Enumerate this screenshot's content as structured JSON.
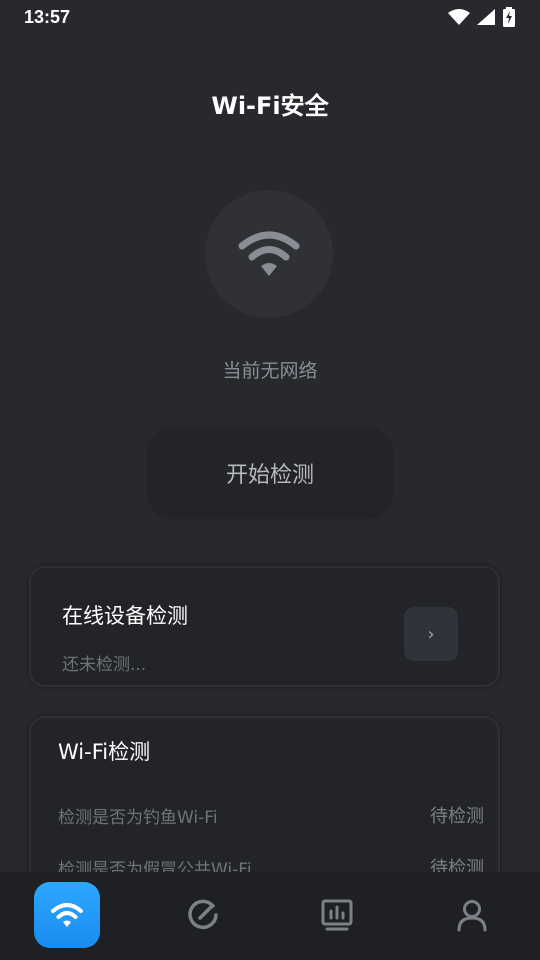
{
  "status_bar": {
    "time": "13:57"
  },
  "header": {
    "title": "Wi-Fi安全"
  },
  "network": {
    "status_text": "当前无网络"
  },
  "actions": {
    "start_label": "开始检测"
  },
  "devices_card": {
    "title": "在线设备检测",
    "subtitle": "还未检测...",
    "arrow": "›"
  },
  "wifi_card": {
    "title": "Wi-Fi检测",
    "items": [
      {
        "label": "检测是否为钓鱼Wi-Fi",
        "status": "待检测"
      },
      {
        "label": "检测是否为假冒公共Wi-Fi",
        "status": "待检测"
      }
    ]
  },
  "tabs": [
    {
      "icon": "wifi-icon",
      "active": true
    },
    {
      "icon": "speedometer-icon",
      "active": false
    },
    {
      "icon": "stats-icon",
      "active": false
    },
    {
      "icon": "profile-icon",
      "active": false
    }
  ],
  "colors": {
    "background": "#27292e",
    "card": "#222428",
    "accent": "#2ea7ff"
  }
}
